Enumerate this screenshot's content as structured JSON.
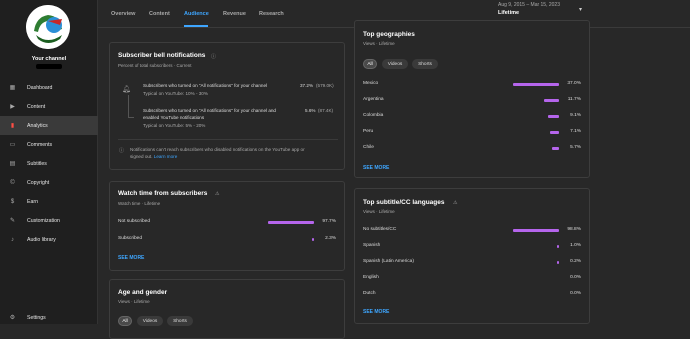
{
  "sidebar": {
    "channel_label": "Your channel",
    "items": [
      {
        "label": "Dashboard",
        "icon": "dashboard-icon"
      },
      {
        "label": "Content",
        "icon": "content-icon"
      },
      {
        "label": "Analytics",
        "icon": "analytics-icon"
      },
      {
        "label": "Comments",
        "icon": "comments-icon"
      },
      {
        "label": "Subtitles",
        "icon": "subtitles-icon"
      },
      {
        "label": "Copyright",
        "icon": "copyright-icon"
      },
      {
        "label": "Earn",
        "icon": "earn-icon"
      },
      {
        "label": "Customization",
        "icon": "customization-icon"
      },
      {
        "label": "Audio library",
        "icon": "audio-library-icon"
      }
    ],
    "settings_label": "Settings"
  },
  "tabs": [
    "Overview",
    "Content",
    "Audience",
    "Revenue",
    "Research"
  ],
  "active_tab": "Audience",
  "date_range": {
    "range": "Aug 9, 2015 – Mar 15, 2023",
    "label": "Lifetime"
  },
  "bell": {
    "title": "Subscriber bell notifications",
    "subtitle": "Percent of total subscribers · Current",
    "row1_text": "Subscribers who turned on \"All notifications\" for your channel",
    "row1_typical": "Typical on YouTube: 10% - 30%",
    "row1_pct": "37.2%",
    "row1_count": "(579.0K)",
    "row2_text_a": "Subscribers who turned on \"All notifications\" for your channel and",
    "row2_text_b": "enabled YouTube notifications",
    "row2_typical": "Typical on YouTube: 5% - 20%",
    "row2_pct": "5.6%",
    "row2_count": "(87.4K)",
    "note_a": "Notifications can't reach subscribers who disabled notifications on the YouTube app or",
    "note_b": "signed out.",
    "learn_more": "Learn more"
  },
  "watch": {
    "title": "Watch time from subscribers",
    "subtitle": "Watch time · Lifetime",
    "rows": [
      {
        "label": "Not subscribed",
        "pct": "97.7%",
        "value": 97.7
      },
      {
        "label": "Subscribed",
        "pct": "2.3%",
        "value": 2.3
      }
    ],
    "see_more": "SEE MORE"
  },
  "age": {
    "title": "Age and gender",
    "subtitle": "Views · Lifetime",
    "chips": [
      "All",
      "Videos",
      "Shorts"
    ]
  },
  "geo": {
    "title": "Top geographies",
    "subtitle": "Views · Lifetime",
    "chips": [
      "All",
      "Videos",
      "Shorts"
    ],
    "rows": [
      {
        "label": "Mexico",
        "pct": "37.0%",
        "value": 37.0
      },
      {
        "label": "Argentina",
        "pct": "11.7%",
        "value": 11.7
      },
      {
        "label": "Colombia",
        "pct": "9.1%",
        "value": 9.1
      },
      {
        "label": "Peru",
        "pct": "7.1%",
        "value": 7.1
      },
      {
        "label": "Chile",
        "pct": "5.7%",
        "value": 5.7
      }
    ],
    "see_more": "SEE MORE"
  },
  "subs": {
    "title": "Top subtitle/CC languages",
    "subtitle": "Views · Lifetime",
    "rows": [
      {
        "label": "No subtitles/CC",
        "pct": "98.8%",
        "value": 98.8
      },
      {
        "label": "Spanish",
        "pct": "1.0%",
        "value": 1.0
      },
      {
        "label": "Spanish (Latin America)",
        "pct": "0.2%",
        "value": 0.2
      },
      {
        "label": "English",
        "pct": "0.0%",
        "value": 0.0
      },
      {
        "label": "Dutch",
        "pct": "0.0%",
        "value": 0.0
      }
    ],
    "see_more": "SEE MORE"
  },
  "colors": {
    "accent": "#3ea6ff",
    "bar": "#b565ec",
    "active_nav": "#ff4e45"
  }
}
